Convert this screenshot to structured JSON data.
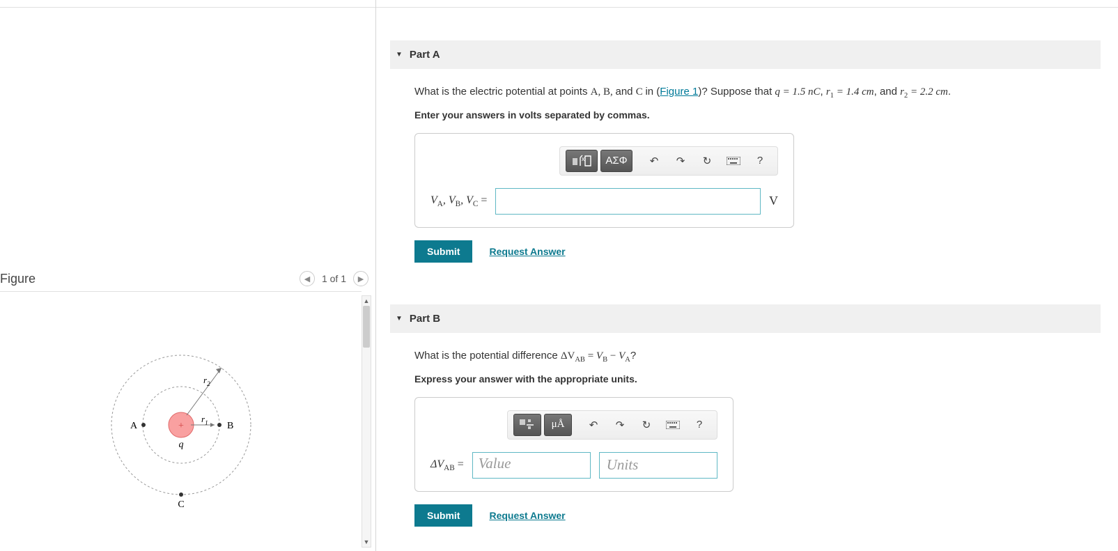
{
  "figure": {
    "title": "Figure",
    "page_indicator": "1 of 1",
    "labels": {
      "A": "A",
      "B": "B",
      "C": "C",
      "q": "q",
      "r1": "r",
      "r1_sub": "1",
      "r2": "r",
      "r2_sub": "2"
    }
  },
  "partA": {
    "title": "Part A",
    "question_pre": "What is the electric potential at points ",
    "pts": "A, B, ",
    "and": "and ",
    "ptC": "C ",
    "in": "in (",
    "figure_link": "Figure 1",
    "post_link": ")? Suppose that ",
    "q_eq": "q = 1.5 nC",
    "sep1": ", ",
    "r1_eq_a": "r",
    "r1_sub": "1",
    "r1_eq_b": " = 1.4 cm",
    "sep2": ", and ",
    "r2_eq_a": "r",
    "r2_sub": "2",
    "r2_eq_b": " = 2.2 cm",
    "period": ".",
    "instruction": "Enter your answers in volts separated by commas.",
    "label_prefix": "V",
    "label_A": "A",
    "label_B": "B",
    "label_C": "C",
    "label_eq": " =",
    "unit": "V",
    "submit": "Submit",
    "request": "Request Answer",
    "tool_greek": "ΑΣΦ",
    "tool_help": "?"
  },
  "partB": {
    "title": "Part B",
    "question_pre": "What is the potential difference ",
    "dvab": "ΔV",
    "sub_ab": "AB",
    "eq": " = ",
    "vb": "V",
    "sub_b": "B",
    "minus": " − ",
    "va": "V",
    "sub_a": "A",
    "qmark": "?",
    "instruction": "Express your answer with the appropriate units.",
    "label": "ΔV",
    "label_sub": "AB",
    "label_eq": " =",
    "value_ph": "Value",
    "units_ph": "Units",
    "submit": "Submit",
    "request": "Request Answer",
    "tool_units": "μÅ",
    "tool_help": "?"
  }
}
